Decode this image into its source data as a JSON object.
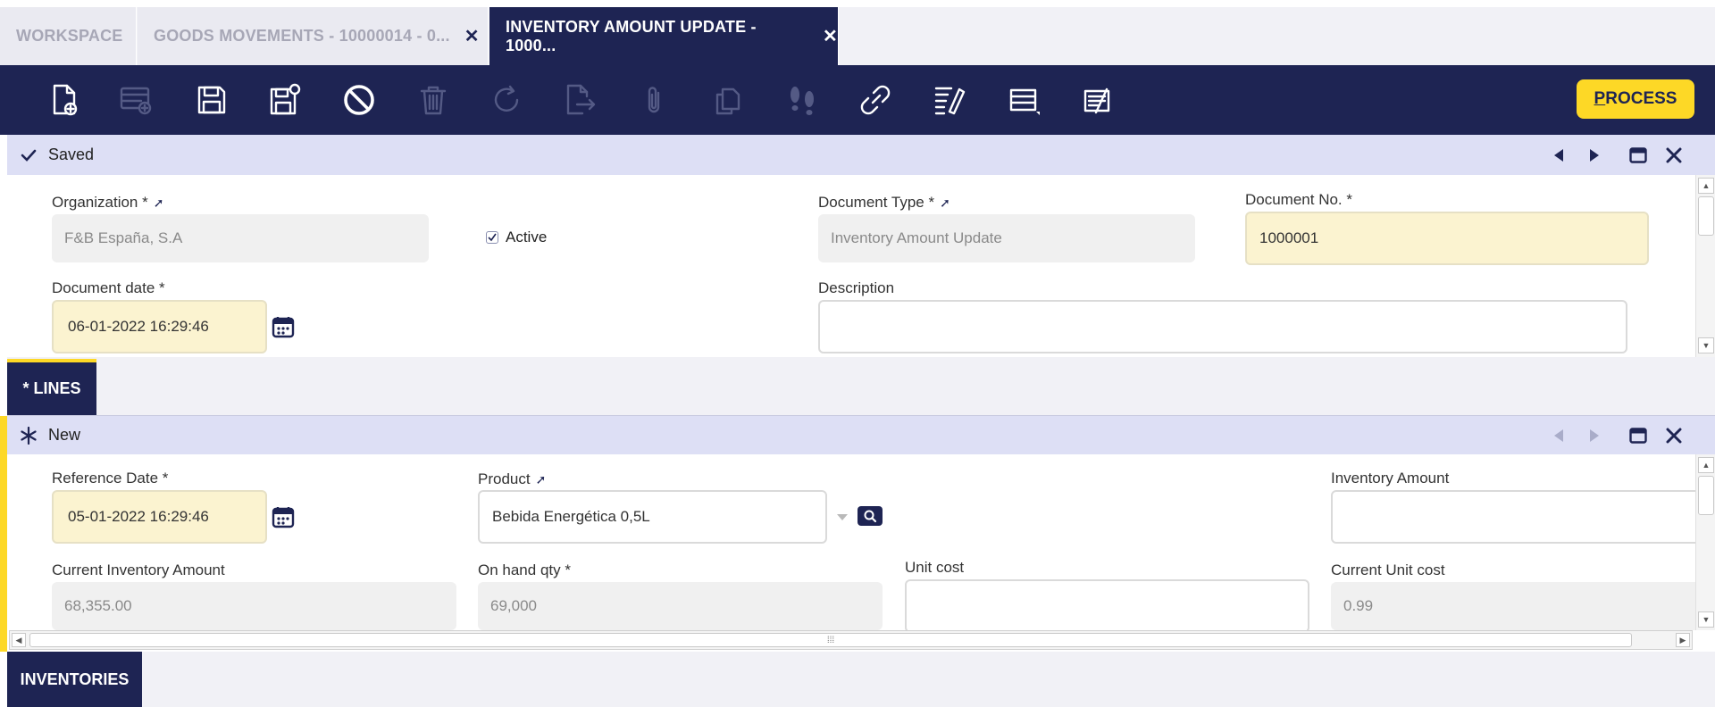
{
  "tabs": [
    {
      "label": "WORKSPACE"
    },
    {
      "label": "GOODS MOVEMENTS - 10000014 - 0...",
      "close": "✕"
    },
    {
      "label": "INVENTORY AMOUNT UPDATE - 1000...",
      "close": "✕"
    }
  ],
  "toolbar": {
    "buttons": [
      {
        "icon": "new-document-icon",
        "enabled": true
      },
      {
        "icon": "new-row-icon",
        "enabled": false
      },
      {
        "icon": "save-icon",
        "enabled": true
      },
      {
        "icon": "save-close-icon",
        "enabled": true
      },
      {
        "icon": "undo-cancel-icon",
        "enabled": true
      },
      {
        "icon": "delete-icon",
        "enabled": false
      },
      {
        "icon": "refresh-icon",
        "enabled": false
      },
      {
        "icon": "export-icon",
        "enabled": false
      },
      {
        "icon": "attachment-icon",
        "enabled": false
      },
      {
        "icon": "clone-icon",
        "enabled": false
      },
      {
        "icon": "audit-trail-icon",
        "enabled": false
      },
      {
        "icon": "link-icon",
        "enabled": true
      },
      {
        "icon": "tree-edit-icon",
        "enabled": true
      },
      {
        "icon": "grid-form-toggle-icon",
        "enabled": true
      },
      {
        "icon": "notes-icon",
        "enabled": true
      }
    ],
    "process_prefix": "P",
    "process_rest": "ROCESS"
  },
  "header": {
    "status": "Saved",
    "fields": {
      "organization": {
        "label": "Organization *",
        "value": "F&B España, S.A"
      },
      "active": {
        "label": "Active",
        "checked": true
      },
      "document_type": {
        "label": "Document Type *",
        "value": "Inventory Amount Update"
      },
      "document_no": {
        "label": "Document No. *",
        "value": "1000001"
      },
      "document_date": {
        "label": "Document date *",
        "value": "06-01-2022 16:29:46"
      },
      "description": {
        "label": "Description",
        "value": ""
      }
    }
  },
  "lines_tab": {
    "label": "* LINES"
  },
  "lines": {
    "status": "New",
    "fields": {
      "reference_date": {
        "label": "Reference Date *",
        "value": "05-01-2022 16:29:46"
      },
      "product": {
        "label": "Product",
        "value": "Bebida Energética 0,5L"
      },
      "inventory_amount": {
        "label": "Inventory Amount",
        "value": ""
      },
      "current_inventory_amount": {
        "label": "Current Inventory Amount",
        "value": "68,355.00"
      },
      "on_hand_qty": {
        "label": "On hand qty *",
        "value": "69,000"
      },
      "unit_cost": {
        "label": "Unit cost",
        "value": ""
      },
      "current_unit_cost": {
        "label": "Current Unit cost",
        "value": "0.99"
      }
    }
  },
  "inventories_tab": {
    "label": "INVENTORIES"
  },
  "colors": {
    "navy": "#1e2453",
    "accent_yellow": "#fdd826",
    "strip": "#dddff5"
  }
}
